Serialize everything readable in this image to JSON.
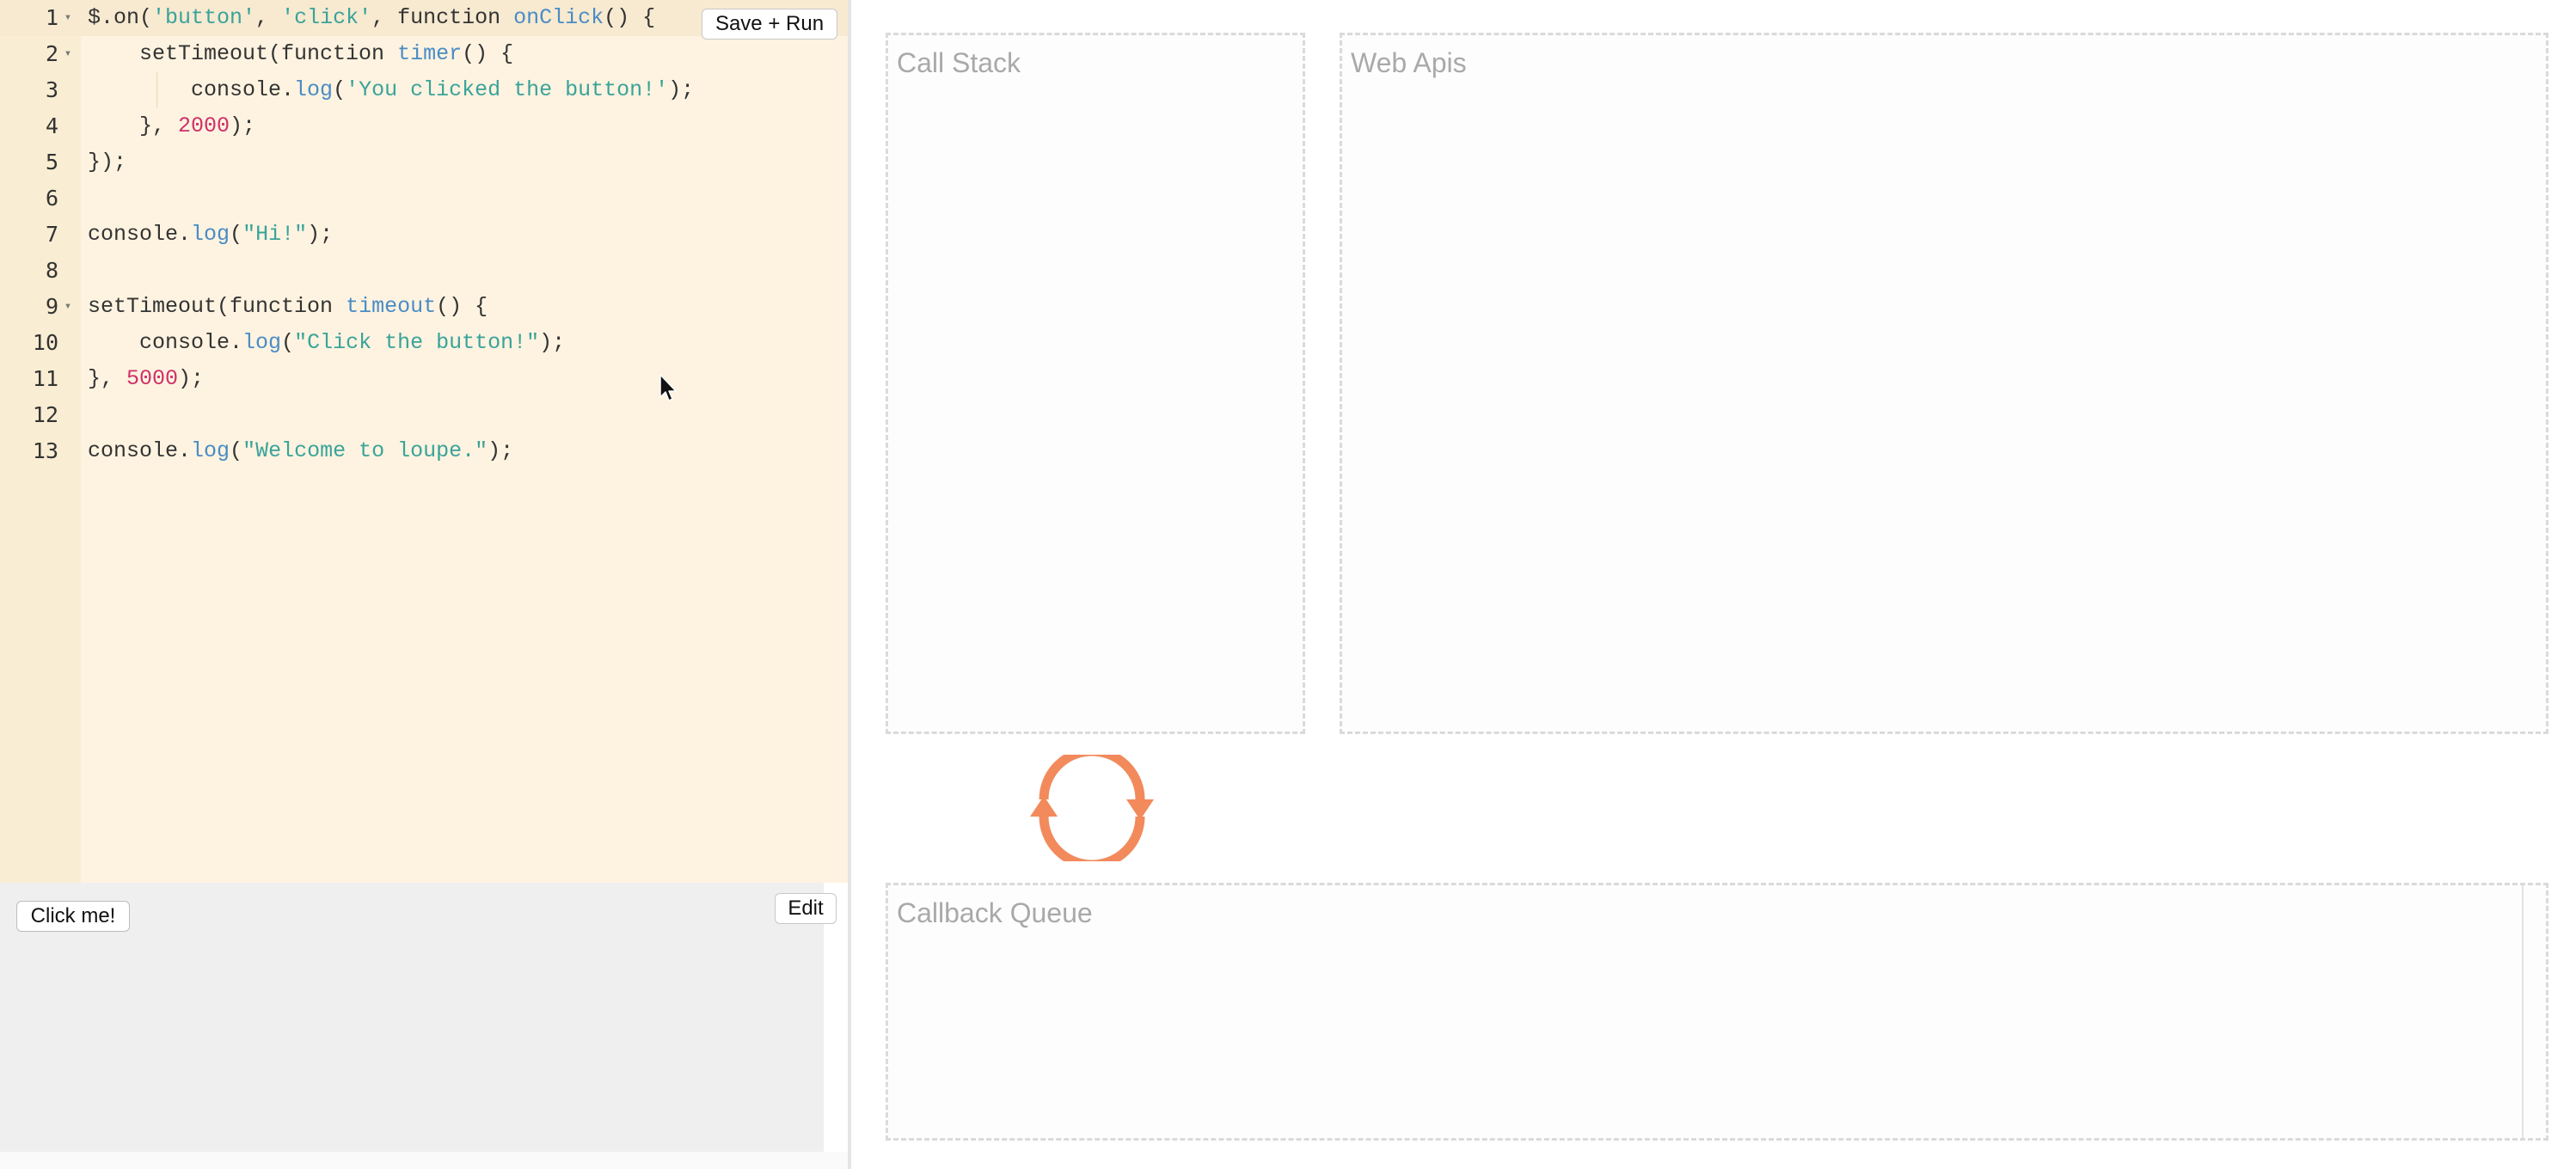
{
  "editor": {
    "save_run_label": "Save + Run",
    "lines": [
      {
        "n": "1",
        "fold": true,
        "tokens": [
          {
            "t": "$.on(",
            "c": "plain"
          },
          {
            "t": "'button'",
            "c": "str"
          },
          {
            "t": ", ",
            "c": "plain"
          },
          {
            "t": "'click'",
            "c": "str"
          },
          {
            "t": ", function ",
            "c": "plain"
          },
          {
            "t": "onClick",
            "c": "fn"
          },
          {
            "t": "() {",
            "c": "plain"
          }
        ]
      },
      {
        "n": "2",
        "fold": true,
        "tokens": [
          {
            "t": "    setTimeout(function ",
            "c": "plain"
          },
          {
            "t": "timer",
            "c": "fn"
          },
          {
            "t": "() {",
            "c": "plain"
          }
        ]
      },
      {
        "n": "3",
        "fold": false,
        "tokens": [
          {
            "t": "        console.",
            "c": "plain"
          },
          {
            "t": "log",
            "c": "fn"
          },
          {
            "t": "(",
            "c": "plain"
          },
          {
            "t": "'You clicked the button!'",
            "c": "str"
          },
          {
            "t": ");",
            "c": "plain"
          }
        ]
      },
      {
        "n": "4",
        "fold": false,
        "tokens": [
          {
            "t": "    }, ",
            "c": "plain"
          },
          {
            "t": "2000",
            "c": "num"
          },
          {
            "t": ");",
            "c": "plain"
          }
        ]
      },
      {
        "n": "5",
        "fold": false,
        "tokens": [
          {
            "t": "});",
            "c": "plain"
          }
        ]
      },
      {
        "n": "6",
        "fold": false,
        "tokens": []
      },
      {
        "n": "7",
        "fold": false,
        "tokens": [
          {
            "t": "console.",
            "c": "plain"
          },
          {
            "t": "log",
            "c": "fn"
          },
          {
            "t": "(",
            "c": "plain"
          },
          {
            "t": "\"Hi!\"",
            "c": "str"
          },
          {
            "t": ");",
            "c": "plain"
          }
        ]
      },
      {
        "n": "8",
        "fold": false,
        "tokens": []
      },
      {
        "n": "9",
        "fold": true,
        "tokens": [
          {
            "t": "setTimeout(function ",
            "c": "plain"
          },
          {
            "t": "timeout",
            "c": "fn"
          },
          {
            "t": "() {",
            "c": "plain"
          }
        ]
      },
      {
        "n": "10",
        "fold": false,
        "tokens": [
          {
            "t": "    console.",
            "c": "plain"
          },
          {
            "t": "log",
            "c": "fn"
          },
          {
            "t": "(",
            "c": "plain"
          },
          {
            "t": "\"Click the button!\"",
            "c": "str"
          },
          {
            "t": ");",
            "c": "plain"
          }
        ]
      },
      {
        "n": "11",
        "fold": false,
        "tokens": [
          {
            "t": "}, ",
            "c": "plain"
          },
          {
            "t": "5000",
            "c": "num"
          },
          {
            "t": ");",
            "c": "plain"
          }
        ]
      },
      {
        "n": "12",
        "fold": false,
        "tokens": []
      },
      {
        "n": "13",
        "fold": false,
        "tokens": [
          {
            "t": "console.",
            "c": "plain"
          },
          {
            "t": "log",
            "c": "fn"
          },
          {
            "t": "(",
            "c": "plain"
          },
          {
            "t": "\"Welcome to loupe.\"",
            "c": "str"
          },
          {
            "t": ");",
            "c": "plain"
          }
        ]
      }
    ]
  },
  "preview": {
    "click_me_label": "Click me!",
    "edit_label": "Edit"
  },
  "visualizer": {
    "call_stack_title": "Call Stack",
    "web_apis_title": "Web Apis",
    "callback_queue_title": "Callback Queue",
    "loop_icon": "event-loop-icon"
  },
  "colors": {
    "editor_bg": "#fdf3e0",
    "gutter_bg": "#f9edd3",
    "string": "#3aa39a",
    "function_name": "#4a8cc5",
    "number": "#d0306a",
    "loop_accent": "#f28a5c",
    "panel_title": "#a9a9a9"
  }
}
